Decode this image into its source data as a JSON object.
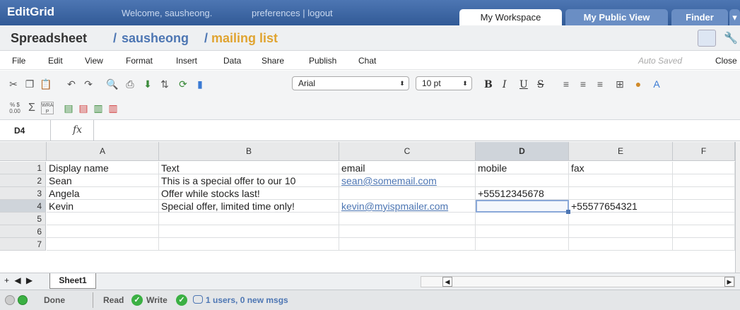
{
  "header": {
    "brand": "EditGrid",
    "welcome": "Welcome, sausheong.",
    "prefs": "preferences | logout",
    "tabs": [
      "My Workspace",
      "My Public View",
      "Finder"
    ]
  },
  "title": {
    "label": "Spreadsheet",
    "sep": "/",
    "user": "sausheong",
    "list": "mailing list"
  },
  "menus": [
    "File",
    "Edit",
    "View",
    "Format",
    "Insert",
    "Data",
    "Share",
    "Publish",
    "Chat"
  ],
  "autosaved": "Auto Saved",
  "close": "Close",
  "toolbar": {
    "font": "Arial",
    "size": "10 pt",
    "pct_label": "% $\n0.00",
    "wrap_label": "WRA\nP"
  },
  "formula": {
    "cellref": "D4",
    "fx": "fx"
  },
  "grid": {
    "columns": [
      "A",
      "B",
      "C",
      "D",
      "E",
      "F"
    ],
    "rows": [
      {
        "num": "1",
        "cells": [
          "Display name",
          "Text",
          "email",
          "mobile",
          "fax",
          ""
        ]
      },
      {
        "num": "2",
        "cells": [
          "Sean",
          "This is a special offer to our 10",
          "sean@somemail.com",
          "",
          "",
          ""
        ]
      },
      {
        "num": "3",
        "cells": [
          "Angela",
          "Offer while stocks last!",
          "",
          "+55512345678",
          "",
          ""
        ]
      },
      {
        "num": "4",
        "cells": [
          "Kevin",
          "Special offer, limited time only!",
          "kevin@myispmailer.com",
          "",
          "+55577654321",
          ""
        ]
      },
      {
        "num": "5",
        "cells": [
          "",
          "",
          "",
          "",
          "",
          ""
        ]
      },
      {
        "num": "6",
        "cells": [
          "",
          "",
          "",
          "",
          "",
          ""
        ]
      },
      {
        "num": "7",
        "cells": [
          "",
          "",
          "",
          "",
          "",
          ""
        ]
      }
    ]
  },
  "sheet": {
    "nav": "+ ◀ ▶",
    "tab": "Sheet1"
  },
  "status": {
    "done": "Done",
    "read": "Read",
    "write": "Write",
    "msgs": "1 users, 0 new msgs"
  }
}
